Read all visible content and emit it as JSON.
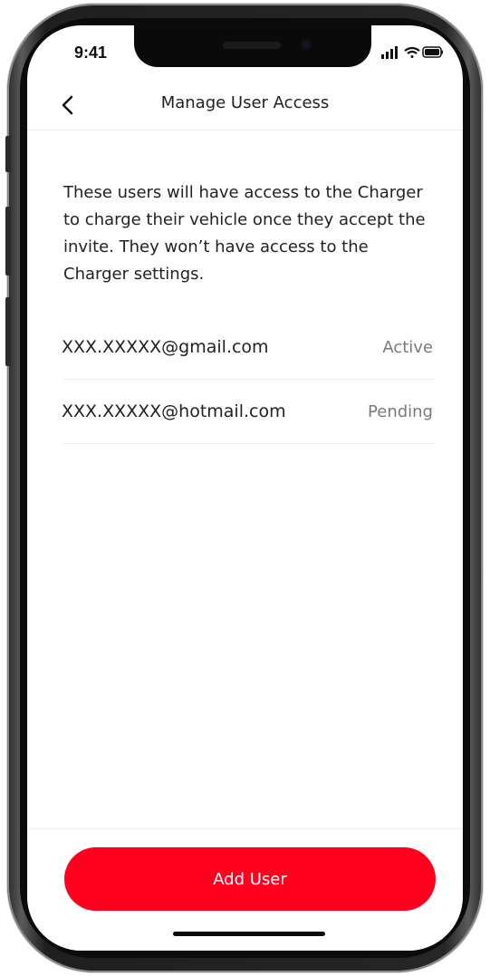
{
  "status_bar": {
    "time": "9:41",
    "icons": [
      "signal-bars-icon",
      "wifi-icon",
      "battery-icon"
    ]
  },
  "header": {
    "title": "Manage User Access",
    "back_icon": "chevron-left-icon"
  },
  "description": "These users will have access to the Charger to charge their vehicle once they accept the invite. They won’t have access to the Charger settings.",
  "users": [
    {
      "email": "XXX.XXXXX@gmail.com",
      "status": "Active"
    },
    {
      "email": "XXX.XXXXX@hotmail.com",
      "status": "Pending"
    }
  ],
  "actions": {
    "add_user_label": "Add User"
  },
  "colors": {
    "accent": "#ff001f",
    "text_primary": "#222222",
    "text_secondary": "#7a7a7a",
    "divider": "#ececec"
  }
}
